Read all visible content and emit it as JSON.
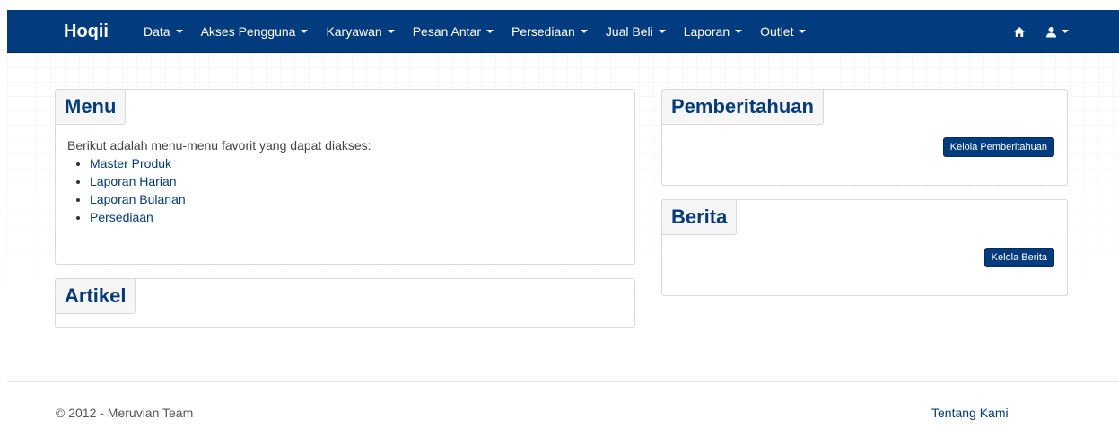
{
  "navbar": {
    "brand": "Hoqii",
    "items": [
      {
        "label": "Data"
      },
      {
        "label": "Akses Pengguna"
      },
      {
        "label": "Karyawan"
      },
      {
        "label": "Pesan Antar"
      },
      {
        "label": "Persediaan"
      },
      {
        "label": "Jual Beli"
      },
      {
        "label": "Laporan"
      },
      {
        "label": "Outlet"
      }
    ],
    "right_icons": [
      "home-icon",
      "user-icon"
    ]
  },
  "menu_panel": {
    "title": "Menu",
    "intro": "Berikut adalah menu-menu favorit yang dapat diakses:",
    "links": [
      "Master Produk",
      "Laporan Harian",
      "Laporan Bulanan",
      "Persediaan"
    ]
  },
  "artikel_panel": {
    "title": "Artikel"
  },
  "pemberitahuan_panel": {
    "title": "Pemberitahuan",
    "button": "Kelola Pemberitahuan"
  },
  "berita_panel": {
    "title": "Berita",
    "button": "Kelola Berita"
  },
  "footer": {
    "copyright": "© 2012 - Meruvian Team",
    "about": "Tentang Kami"
  },
  "colors": {
    "primary": "#033c7e",
    "panel_title_bg": "#f6f6f6",
    "border": "#d9d9d9"
  }
}
